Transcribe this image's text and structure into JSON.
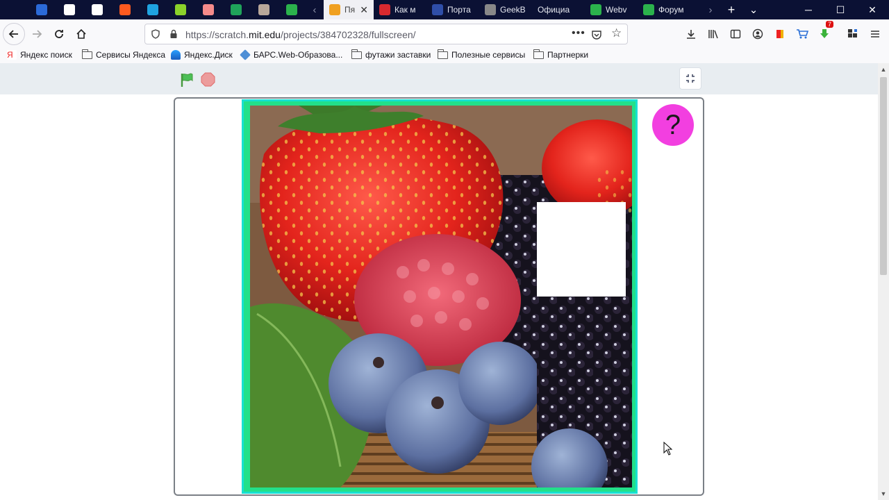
{
  "browser": {
    "tab_strip": {
      "pinned_icons": [
        {
          "icon": "mail-icon",
          "color": "#2b6ad8"
        },
        {
          "icon": "chatgpt-icon",
          "color": "#ffffff"
        },
        {
          "icon": "pause-app-icon",
          "color": "#ffffff"
        },
        {
          "icon": "orange-circle-icon",
          "color": "#ff5a1f"
        },
        {
          "icon": "heartbeat-icon",
          "color": "#1fa3e0"
        },
        {
          "icon": "green-leaf-icon",
          "color": "#8bd12a"
        },
        {
          "icon": "ice-cream-icon",
          "color": "#f58a8a"
        },
        {
          "icon": "green-plus-icon",
          "color": "#1fa35a"
        },
        {
          "icon": "avatar-icon",
          "color": "#b8a79a"
        },
        {
          "icon": "kt-icon",
          "color": "#2bb24c"
        }
      ],
      "tabs": [
        {
          "label": "Пя",
          "icon": "lightbulb-icon",
          "color": "#f0a020",
          "active": true
        },
        {
          "label": "Как м",
          "icon": "ips-icon",
          "color": "#d8292f",
          "active": false
        },
        {
          "label": "Порта",
          "icon": "russia-flag-icon",
          "color": "#2f4ea8",
          "active": false
        },
        {
          "label": "GeekB",
          "icon": "geekbrains-icon",
          "color": "#888888",
          "active": false
        },
        {
          "label": "Официа",
          "icon": "",
          "color": "",
          "active": false
        },
        {
          "label": "Webv",
          "icon": "webvork-icon",
          "color": "#2bb24c",
          "active": false
        },
        {
          "label": "Форум",
          "icon": "forum-icon",
          "color": "#2bb24c",
          "active": false
        }
      ]
    },
    "navigation": {
      "url_prefix": "https://scratch.",
      "url_domain": "mit.edu",
      "url_suffix": "/projects/384702328/fullscreen/",
      "download_badge": "7"
    },
    "bookmarks": [
      {
        "label": "Яндекс поиск",
        "type": "yandex"
      },
      {
        "label": "Сервисы Яндекса",
        "type": "folder"
      },
      {
        "label": "Яндекс.Диск",
        "type": "disk"
      },
      {
        "label": "БАРС.Web-Образова...",
        "type": "bars"
      },
      {
        "label": "футажи заставки",
        "type": "folder"
      },
      {
        "label": "Полезные сервисы",
        "type": "folder"
      },
      {
        "label": "Партнерки",
        "type": "folder"
      }
    ]
  },
  "scratch": {
    "help_label": "?",
    "accent_flag": "#4cbf56",
    "accent_stop": "#ec9c9c",
    "frame_color": "#22e08a",
    "frame_border": "#18e0d2",
    "help_color": "#f23fe0"
  }
}
